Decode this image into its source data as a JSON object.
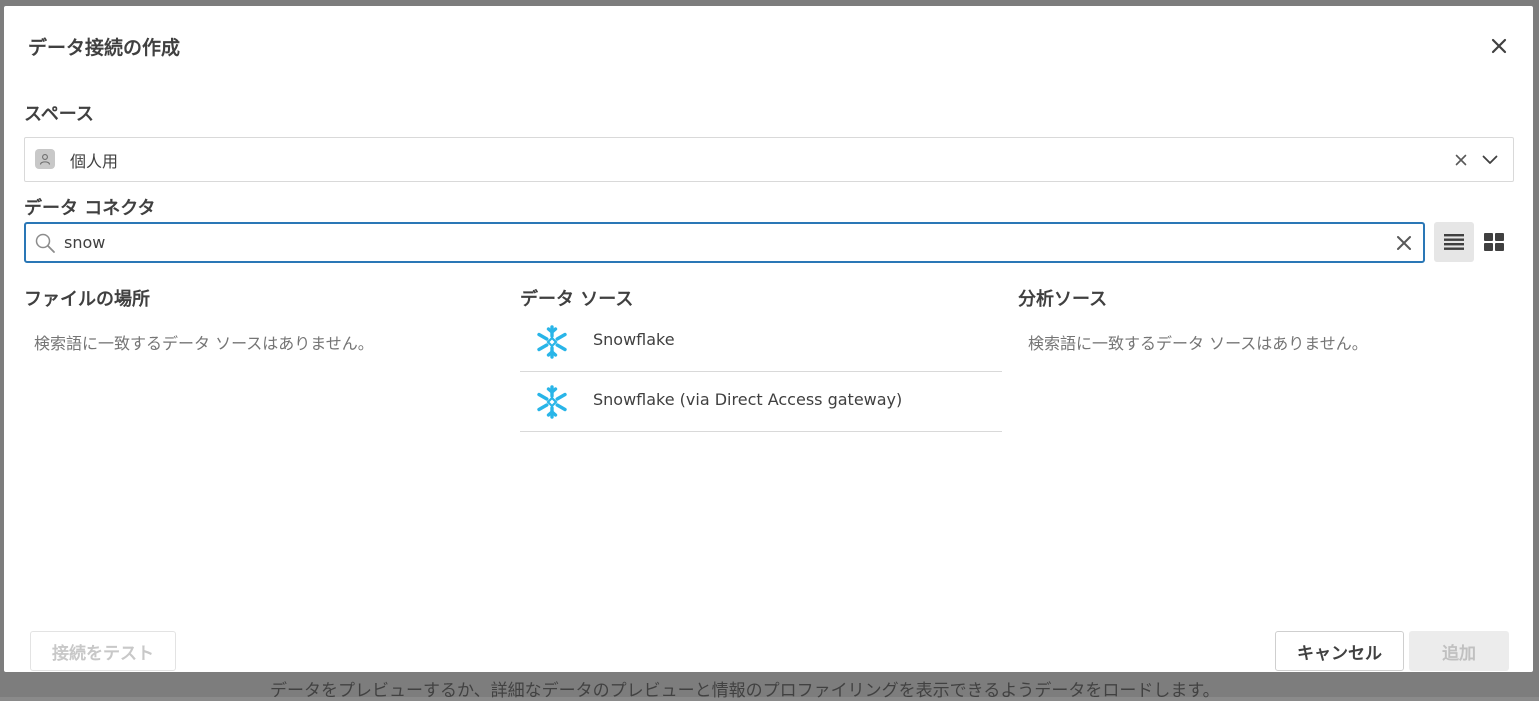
{
  "background": {
    "footer_text": "データをプレビューするか、詳細なデータのプレビューと情報のプロファイリングを表示できるようデータをロードします。"
  },
  "dialog": {
    "title": "データ接続の作成",
    "close_icon": "close-icon"
  },
  "space": {
    "label": "スペース",
    "value": "個人用",
    "avatar_icon": "person-icon",
    "clear_icon": "clear-icon",
    "dropdown_icon": "chevron-down-icon"
  },
  "connector": {
    "label": "データ コネクタ",
    "search_value": "snow",
    "search_icon": "search-icon",
    "clear_icon": "clear-icon",
    "view_modes": [
      "list-view-icon",
      "grid-view-icon"
    ],
    "active_view": "list"
  },
  "columns": {
    "file_locations": {
      "heading": "ファイルの場所",
      "empty_message": "検索語に一致するデータ ソースはありません。"
    },
    "data_sources": {
      "heading": "データ ソース",
      "items": [
        {
          "name": "Snowflake",
          "icon": "snowflake-icon"
        },
        {
          "name": "Snowflake (via Direct Access gateway)",
          "icon": "snowflake-icon"
        }
      ]
    },
    "analytics_sources": {
      "heading": "分析ソース",
      "empty_message": "検索語に一致するデータ ソースはありません。"
    }
  },
  "footer": {
    "test_button": "接続をテスト",
    "cancel_button": "キャンセル",
    "add_button": "追加"
  },
  "colors": {
    "accent": "#2a77b6",
    "snowflake": "#29b5e8",
    "text": "#404040",
    "muted_text": "#757575"
  }
}
